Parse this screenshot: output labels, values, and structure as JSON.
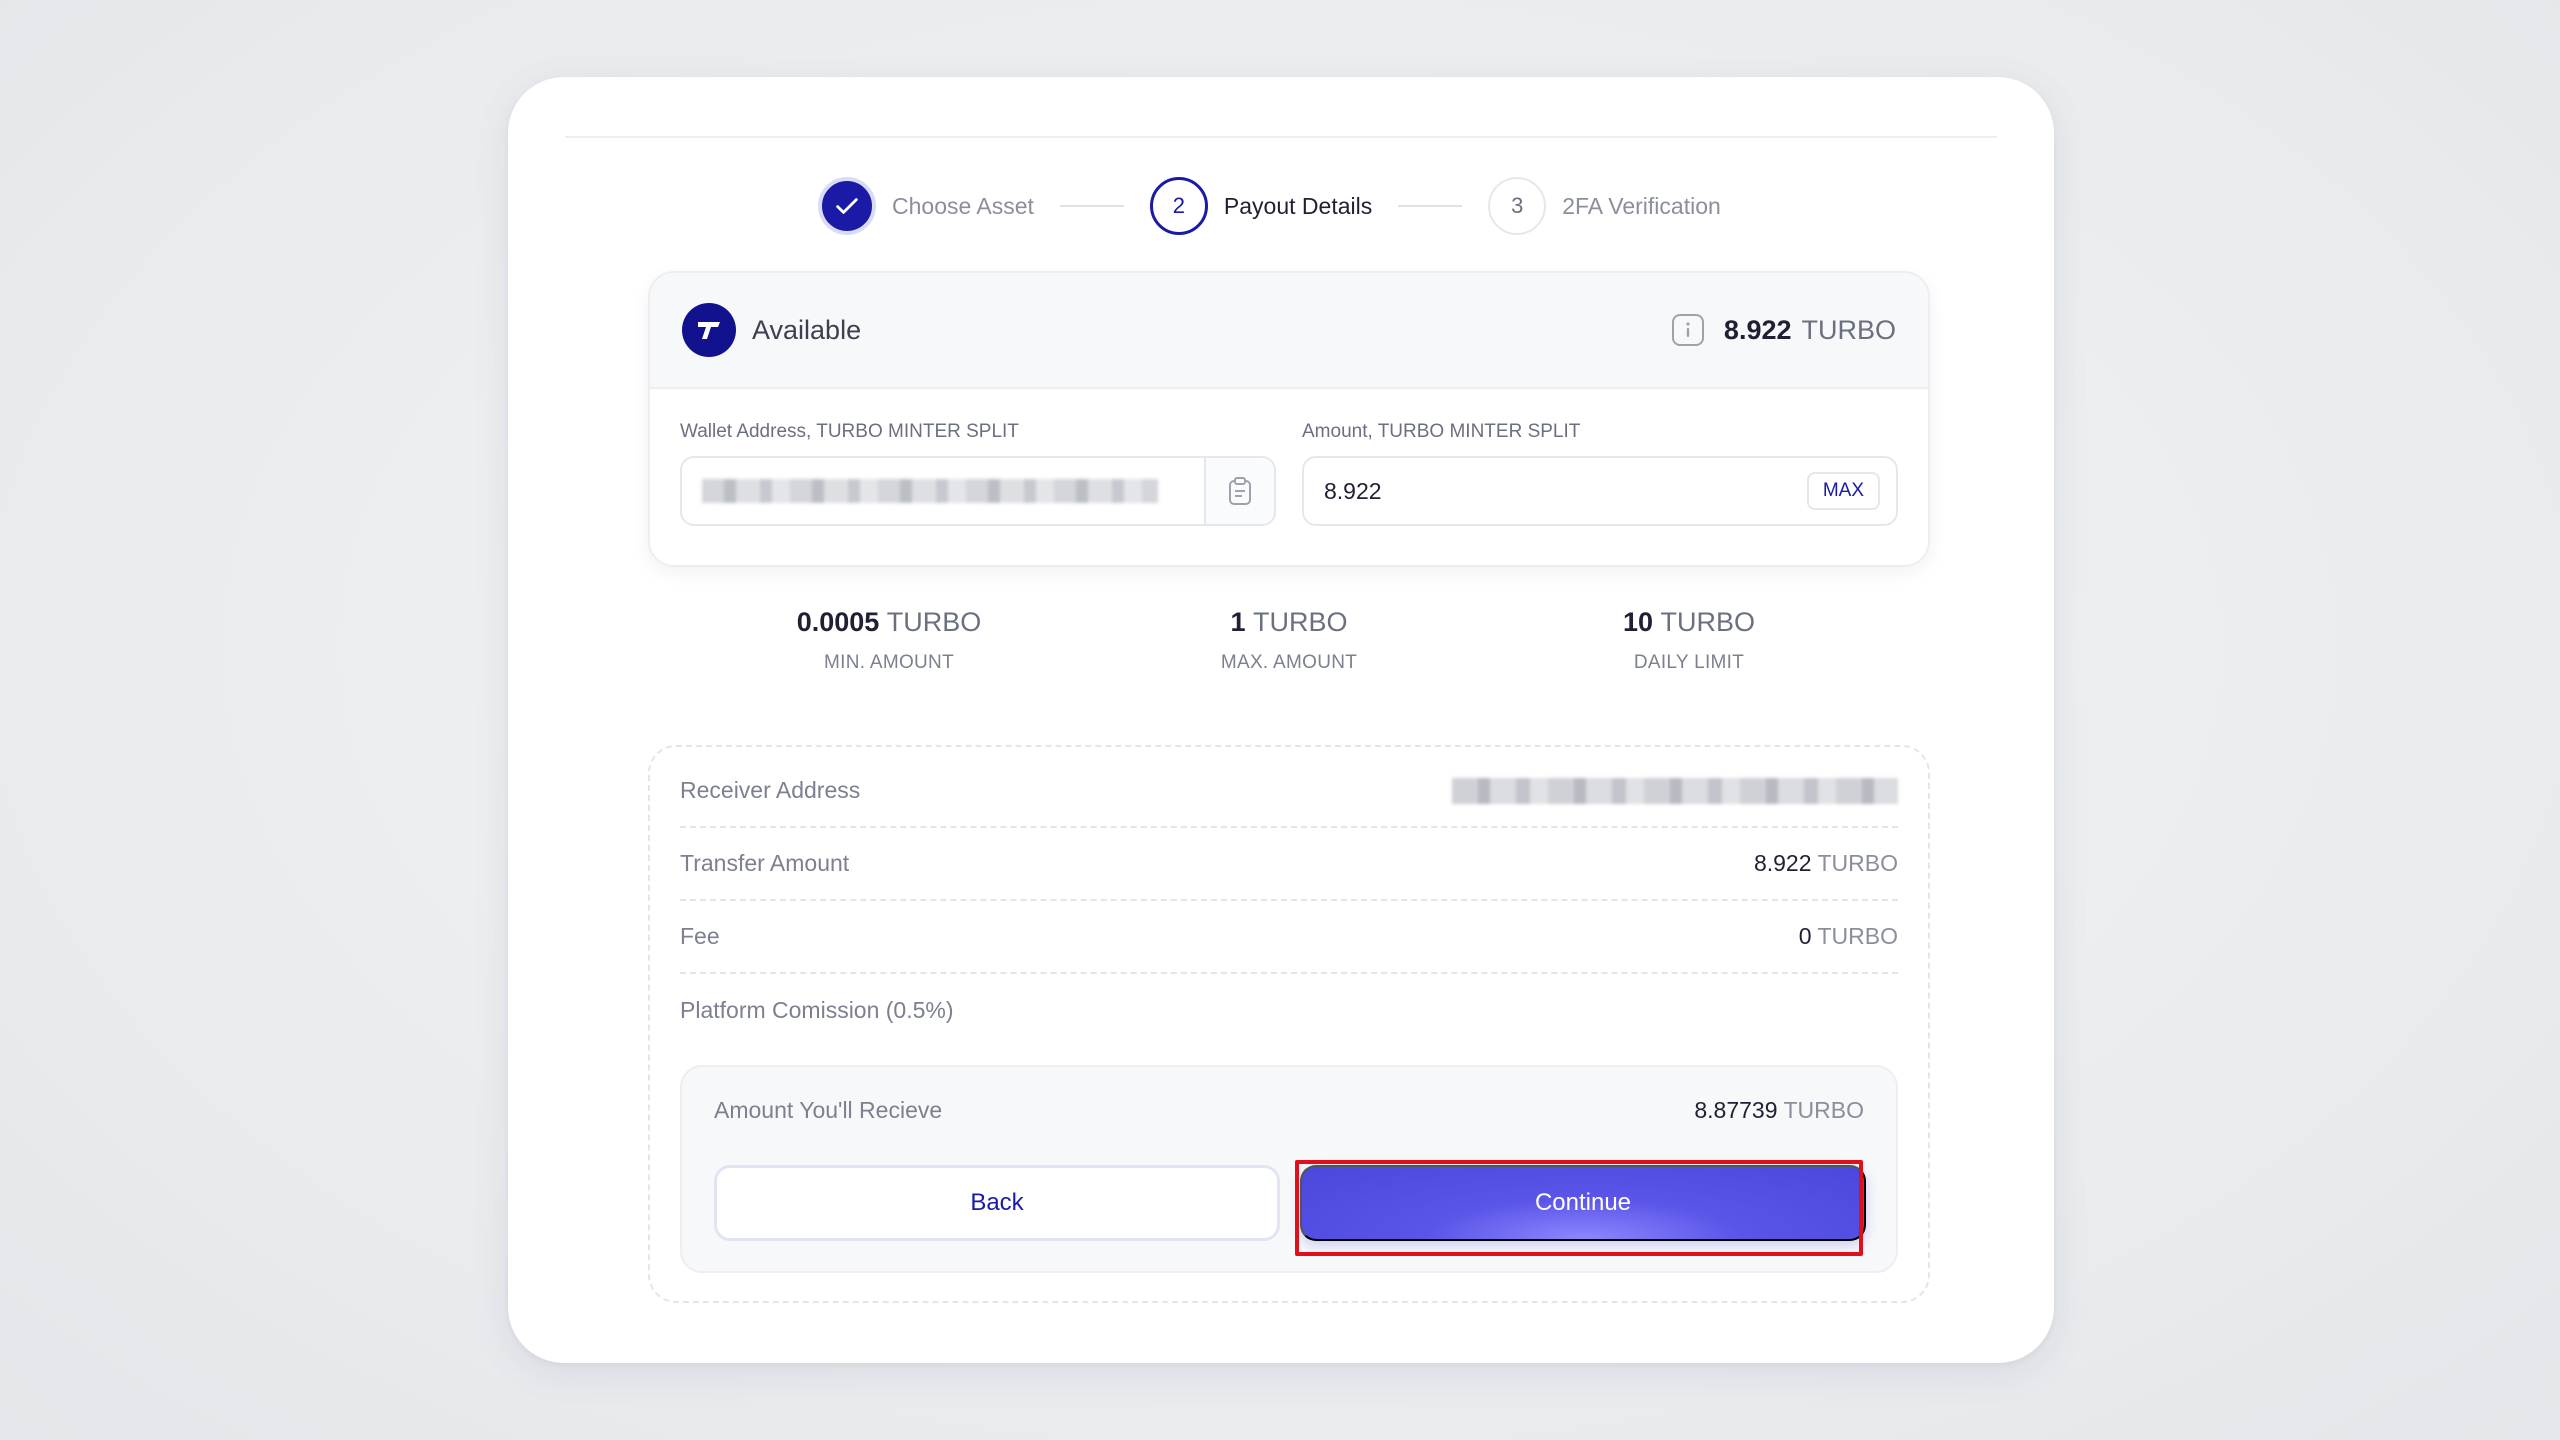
{
  "stepper": {
    "steps": [
      {
        "number": "",
        "label": "Choose Asset",
        "state": "done"
      },
      {
        "number": "2",
        "label": "Payout Details",
        "state": "active"
      },
      {
        "number": "3",
        "label": "2FA Verification",
        "state": "todo"
      }
    ]
  },
  "available": {
    "label": "Available",
    "value": "8.922",
    "unit": "TURBO",
    "icons": {
      "logo": "turbo-logo-icon",
      "info": "info-icon"
    }
  },
  "form": {
    "wallet_label": "Wallet Address, TURBO MINTER SPLIT",
    "amount_label": "Amount, TURBO MINTER SPLIT",
    "amount_value": "8.922",
    "max_label": "MAX",
    "paste_icon": "clipboard-icon"
  },
  "limits": [
    {
      "value": "0.0005",
      "unit": "TURBO",
      "caption": "MIN. AMOUNT"
    },
    {
      "value": "1",
      "unit": "TURBO",
      "caption": "MAX. AMOUNT"
    },
    {
      "value": "10",
      "unit": "TURBO",
      "caption": "DAILY LIMIT"
    }
  ],
  "summary": {
    "receiver_label": "Receiver Address",
    "transfer_label": "Transfer Amount",
    "transfer_value": "8.922",
    "transfer_unit": "TURBO",
    "fee_label": "Fee",
    "fee_value": "0",
    "fee_unit": "TURBO",
    "commission_label": "Platform Comission (0.5%)",
    "receive_label": "Amount You'll Recieve",
    "receive_value": "8.87739",
    "receive_unit": "TURBO"
  },
  "buttons": {
    "back": "Back",
    "continue": "Continue"
  },
  "colors": {
    "brand": "#1a1aa6",
    "continue": "#5a54e8",
    "highlight": "#e0101a"
  }
}
